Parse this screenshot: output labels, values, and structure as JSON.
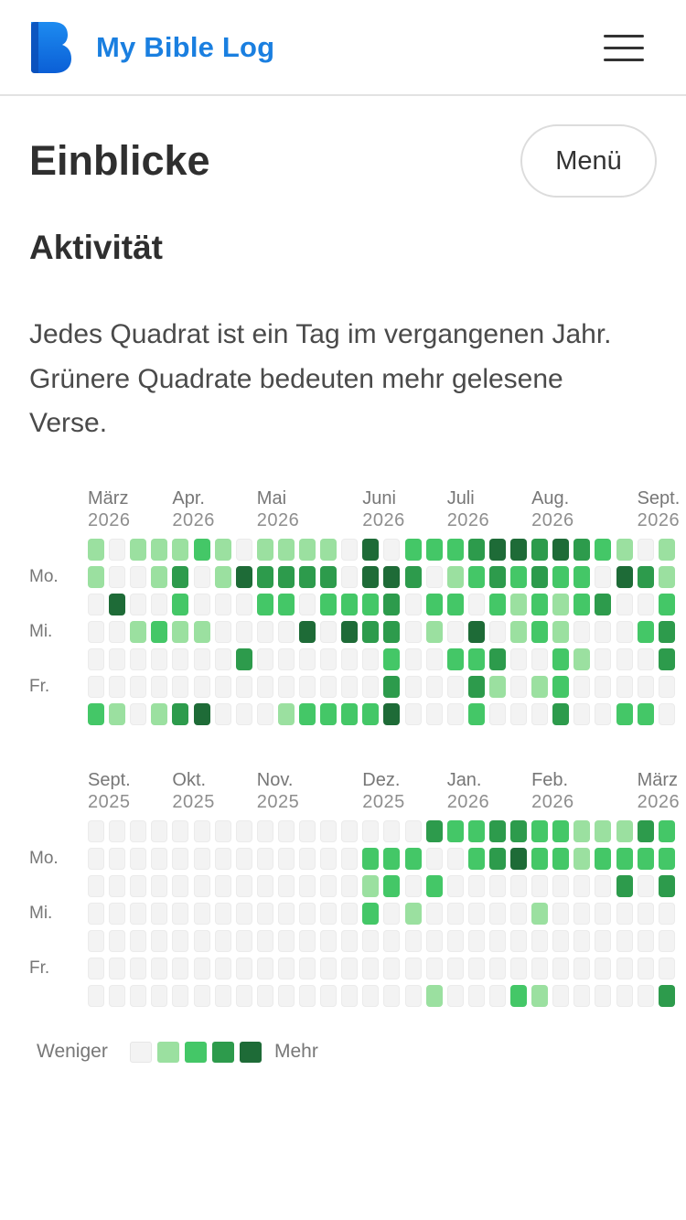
{
  "app": {
    "title": "My Bible Log"
  },
  "page": {
    "title": "Einblicke",
    "menu_button": "Menü",
    "section_title": "Aktivität",
    "description": "Jedes Quadrat ist ein Tag im vergangenen Jahr. Grünere Quadrate bedeuten mehr gelesene Verse."
  },
  "colors": {
    "brand": "#1a7fe0",
    "levels": [
      "#eeeeee",
      "#9be0a0",
      "#44c767",
      "#2d9b4c",
      "#1e6b37"
    ]
  },
  "icons": {
    "logo": "book-b-logo",
    "menu": "hamburger-menu-icon"
  },
  "heatmaps": [
    {
      "months": [
        {
          "name": "März",
          "year": "2026"
        },
        {
          "name": "Apr.",
          "year": "2026"
        },
        {
          "name": "Mai",
          "year": "2026"
        },
        {
          "name": "Juni",
          "year": "2026"
        },
        {
          "name": "Juli",
          "year": "2026"
        },
        {
          "name": "Aug.",
          "year": "2026"
        },
        {
          "name": "Sept.",
          "year": "2026"
        }
      ],
      "day_labels": [
        "Mo.",
        "Mi.",
        "Fr."
      ],
      "grid": [
        "1011121011110402223443432101",
        "1001301433330443012323220431",
        "0400200022022230220212123002",
        "0012110000404330104012100023",
        "0000000300000020022300210003",
        "0000000000000030003101200000",
        "2101340001222240002000300220"
      ]
    },
    {
      "months": [
        {
          "name": "Sept.",
          "year": "2025"
        },
        {
          "name": "Okt.",
          "year": "2025"
        },
        {
          "name": "Nov.",
          "year": "2025"
        },
        {
          "name": "Dez.",
          "year": "2025"
        },
        {
          "name": "Jan.",
          "year": "2026"
        },
        {
          "name": "Feb.",
          "year": "2026"
        },
        {
          "name": "März",
          "year": "2026"
        }
      ],
      "day_labels": [
        "Mo.",
        "Mi.",
        "Fr."
      ],
      "grid": [
        "0000000000000000322332211132",
        "0000000000000222002342212222",
        "0000000000000120200000000303",
        "0000000000000201000001000000",
        "0000000000000000000000000000",
        "0000000000000000000000000000",
        "0000000000000000100021000003"
      ]
    }
  ],
  "legend": {
    "less": "Weniger",
    "more": "Mehr"
  }
}
